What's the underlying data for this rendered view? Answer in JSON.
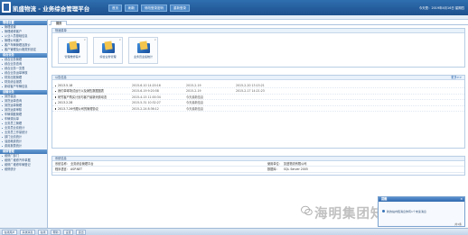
{
  "header": {
    "app_title": "凯盛物流 - 业务综合管理平台",
    "nav": [
      "首页",
      "刷新",
      "修改登录密码",
      "重新登录"
    ],
    "right_info": "今天是：2019年4月16日 星期四"
  },
  "sidebar": {
    "groups": [
      {
        "title": "管理设置",
        "items": [
          "管理设置",
          "管理维修客户",
          "从业人员基础信息",
          "管理公司客户",
          "客户车辆管理及报价",
          "客户管理及价格类别设定"
        ]
      },
      {
        "title": "综合业务",
        "items": [
          "综合业务管理",
          "综合业务查询",
          "综合业务一览表",
          "综合业务运单审核",
          "财务出账管理",
          "财务综合报表",
          "新增客户车辆信息"
        ]
      },
      {
        "title": "运输业务",
        "items": [
          "到货装运",
          "到货运单查询",
          "到货运单管理",
          "到货运费审核",
          "车辆调度管理",
          "车辆调派单",
          "业务员工管理",
          "业务员业绩统计",
          "业务员工作量统计",
          "部门业绩统计",
          "油品耗费统计",
          "费用报表统计"
        ]
      },
      {
        "title": "维修管理",
        "items": [
          "维修厂部门",
          "维修厂维修汽车单据",
          "维修厂维修车辆登记",
          "维修统计"
        ]
      }
    ]
  },
  "main": {
    "tab": "首页",
    "quick_menu_title": "快速菜单",
    "shortcuts": [
      "管理维修客户",
      "综合业务管理",
      "业务员业绩统计"
    ],
    "announce_title": "公告信息",
    "announce_more": "更多>>",
    "announcements": [
      {
        "title": "2013.5.18",
        "d1": "2015-6-10 14:20:16",
        "d2": "2015-2-19",
        "d3": "2015-2-20 13:15:21"
      },
      {
        "title": "我们单球场试运行以及销售数据图表",
        "d1": "2015-6-19 9:20:58",
        "d2": "2015-2-19",
        "d3": "2015-2-17 14:21:23"
      },
      {
        "title": "研究客户购买计划与客户最新消费动态",
        "d1": "2015-4-15 11:00:34",
        "d2": "今天最新信息",
        "d3": ""
      },
      {
        "title": "2013.2.28",
        "d1": "2015-5-31 10:32:27",
        "d2": "今天最新信息",
        "d3": ""
      },
      {
        "title": "2013.7.26代理公司的管理协议",
        "d1": "2015-2-24 8:36:12",
        "d2": "今天最新信息",
        "d3": ""
      }
    ],
    "sysinfo_title": "系统信息",
    "sysinfo": [
      {
        "label": "系统名称：",
        "value": "业务综合管理平台",
        "label2": "使用单位：",
        "value2": "凯盛物流有限公司"
      },
      {
        "label": "程序语言：",
        "value": "ASP.NET",
        "label2": "数据库：",
        "value2": "SQL Server 2005"
      }
    ]
  },
  "popup": {
    "title": "提醒",
    "close": "×",
    "message": "新的站内短消息你有1个未读消息",
    "count": "共1条"
  },
  "statusbar": [
    "在线用户",
    "系统消息",
    "在线",
    "帮助",
    "设置",
    "退出"
  ],
  "watermark": "海明集团知识科技"
}
